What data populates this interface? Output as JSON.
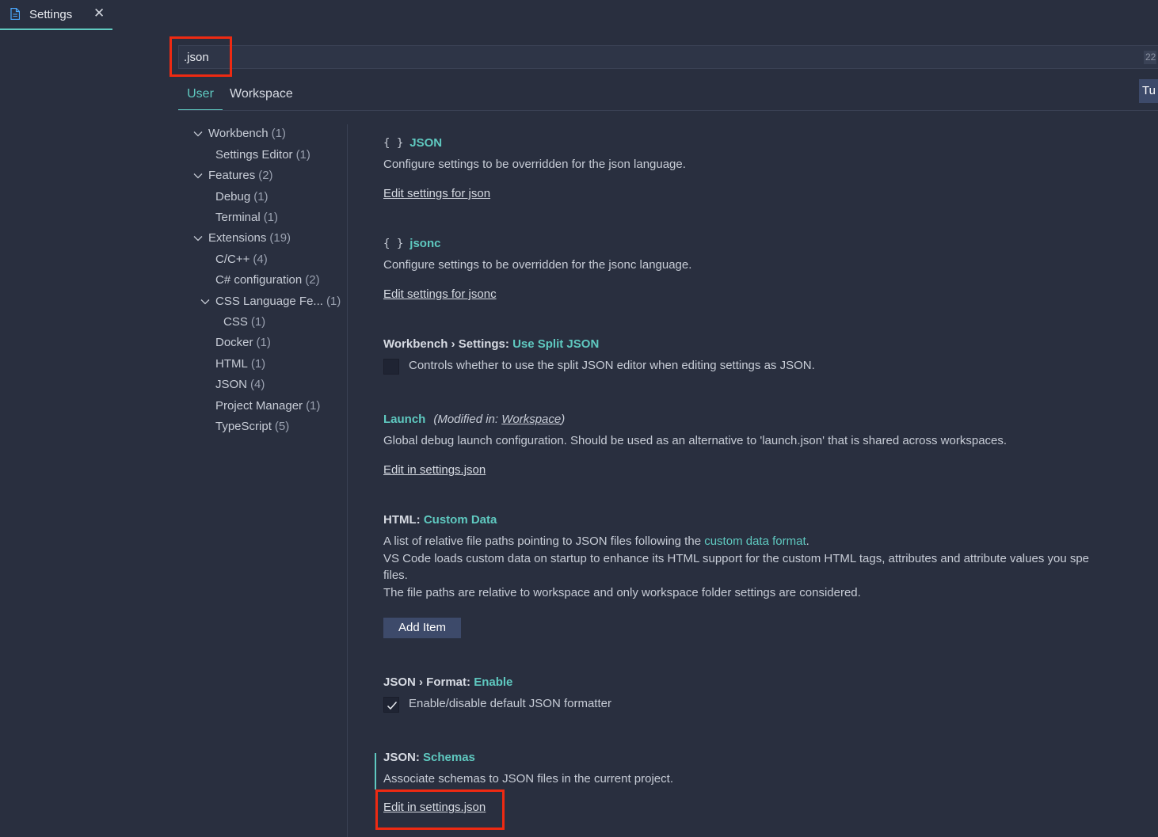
{
  "tab": {
    "label": "Settings",
    "close_glyph": "✕",
    "icon": "file-icon"
  },
  "search": {
    "value": ".json",
    "result_count": "22"
  },
  "scope_tabs": {
    "user": "User",
    "workspace": "Workspace",
    "right_button": "Tu"
  },
  "toc": [
    {
      "label": "Workbench",
      "count": "(1)",
      "expanded": true
    },
    {
      "label": "Settings Editor",
      "count": "(1)"
    },
    {
      "label": "Features",
      "count": "(2)",
      "expanded": true
    },
    {
      "label": "Debug",
      "count": "(1)"
    },
    {
      "label": "Terminal",
      "count": "(1)"
    },
    {
      "label": "Extensions",
      "count": "(19)",
      "expanded": true
    },
    {
      "label": "C/C++",
      "count": "(4)"
    },
    {
      "label": "C# configuration",
      "count": "(2)"
    },
    {
      "label": "CSS Language Fe...",
      "count": "(1)",
      "expanded": true
    },
    {
      "label": "CSS",
      "count": "(1)"
    },
    {
      "label": "Docker",
      "count": "(1)"
    },
    {
      "label": "HTML",
      "count": "(1)"
    },
    {
      "label": "JSON",
      "count": "(4)"
    },
    {
      "label": "Project Manager",
      "count": "(1)"
    },
    {
      "label": "TypeScript",
      "count": "(5)"
    }
  ],
  "settings": {
    "json_lang": {
      "braces": "{ }",
      "key": "JSON",
      "description": "Configure settings to be overridden for the json language.",
      "link": "Edit settings for json"
    },
    "jsonc_lang": {
      "braces": "{ }",
      "key": "jsonc",
      "description": "Configure settings to be overridden for the jsonc language.",
      "link": "Edit settings for jsonc"
    },
    "split_json": {
      "category": "Workbench › Settings: ",
      "key": "Use Split JSON",
      "checked": false,
      "description": "Controls whether to use the split JSON editor when editing settings as JSON."
    },
    "launch": {
      "key": "Launch",
      "modified_prefix": "(Modified in: ",
      "modified_link": "Workspace",
      "modified_suffix": ")",
      "description": "Global debug launch configuration. Should be used as an alternative to 'launch.json' that is shared across workspaces.",
      "link": "Edit in settings.json"
    },
    "html_custom_data": {
      "category": "HTML: ",
      "key": "Custom Data",
      "desc_1_pre": "A list of relative file paths pointing to JSON files following the ",
      "desc_1_link": "custom data format",
      "desc_1_post": ".",
      "desc_2": "VS Code loads custom data on startup to enhance its HTML support for the custom HTML tags, attributes and attribute values you spe",
      "desc_3": "files.",
      "desc_4": "The file paths are relative to workspace and only workspace folder settings are considered.",
      "button": "Add Item"
    },
    "json_format": {
      "category": "JSON › Format: ",
      "key": "Enable",
      "checked": true,
      "description": "Enable/disable default JSON formatter"
    },
    "json_schemas": {
      "category": "JSON: ",
      "key": "Schemas",
      "description": "Associate schemas to JSON files in the current project.",
      "link": "Edit in settings.json"
    }
  },
  "colors": {
    "accent": "#5fc9c0",
    "background": "#292f3f",
    "highlight_box": "#ee2a12",
    "button": "#3d4a6a"
  }
}
